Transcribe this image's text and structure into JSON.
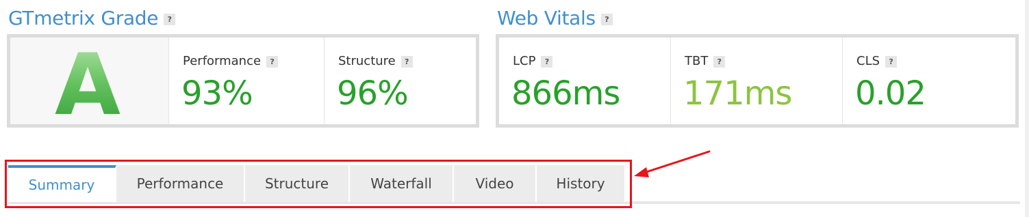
{
  "grade_section": {
    "title": "GTmetrix Grade",
    "help": "?",
    "grade": "A",
    "metrics": [
      {
        "label": "Performance",
        "value": "93%",
        "color": "#27a12a"
      },
      {
        "label": "Structure",
        "value": "96%",
        "color": "#27a12a"
      }
    ]
  },
  "vitals_section": {
    "title": "Web Vitals",
    "help": "?",
    "metrics": [
      {
        "label": "LCP",
        "value": "866ms",
        "color": "#27a12a"
      },
      {
        "label": "TBT",
        "value": "171ms",
        "color": "#8cc43f"
      },
      {
        "label": "CLS",
        "value": "0.02",
        "color": "#27a12a"
      }
    ]
  },
  "tabs": [
    {
      "label": "Summary",
      "active": true
    },
    {
      "label": "Performance",
      "active": false
    },
    {
      "label": "Structure",
      "active": false
    },
    {
      "label": "Waterfall",
      "active": false
    },
    {
      "label": "Video",
      "active": false
    },
    {
      "label": "History",
      "active": false
    }
  ],
  "colors": {
    "accent": "#3f8fcf",
    "good": "#27a12a",
    "ok": "#8cc43f",
    "annotation": "#e8141b"
  },
  "icons": {
    "help": "question-mark-icon",
    "annotation_arrow": "arrow-left-icon"
  }
}
